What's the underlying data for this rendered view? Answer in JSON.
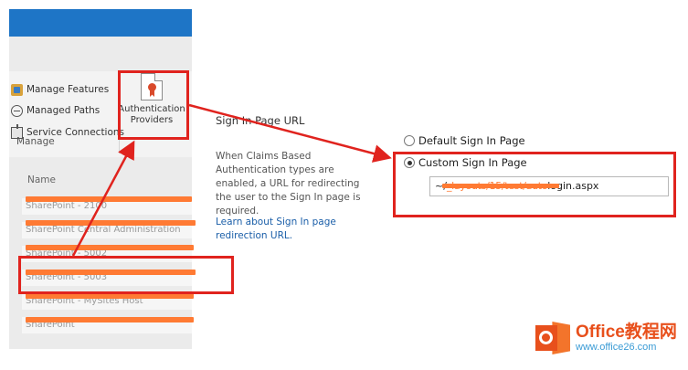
{
  "ribbon": {
    "items": [
      {
        "label": "Manage Features",
        "icon": "features-icon"
      },
      {
        "label": "Managed Paths",
        "icon": "globe-icon"
      },
      {
        "label": "Service Connections",
        "icon": "connection-icon"
      }
    ],
    "group_label": "Manage",
    "auth_tile": {
      "line1": "Authentication",
      "line2": "Providers",
      "icon": "certificate-document-icon"
    }
  },
  "list": {
    "header": "Name",
    "rows": [
      {
        "text": "SharePoint - 2100"
      },
      {
        "text": "SharePoint Central Administration"
      },
      {
        "text": "SharePoint - 5002"
      },
      {
        "text": "SharePoint - 5003"
      },
      {
        "text": "SharePoint - MySites Host"
      },
      {
        "text": "SharePoint"
      }
    ]
  },
  "settings": {
    "title": "Sign In Page URL",
    "description": "When Claims Based Authentication types are enabled, a URL for redirecting the user to the Sign In page is required.",
    "help_link": "Learn about Sign In page redirection URL.",
    "options": [
      {
        "label": "Default Sign In Page",
        "checked": false
      },
      {
        "label": "Custom Sign In Page",
        "checked": true
      }
    ],
    "url_prefix": "~/",
    "url_redacted": "_layouts/15/test/auto",
    "url_suffix": "login.aspx"
  },
  "watermark": {
    "title": "Office教程网",
    "url": "www.office26.com"
  },
  "colors": {
    "annotation": "#e0231e",
    "redaction": "#ff7a33",
    "topbar": "#1e75c6"
  }
}
